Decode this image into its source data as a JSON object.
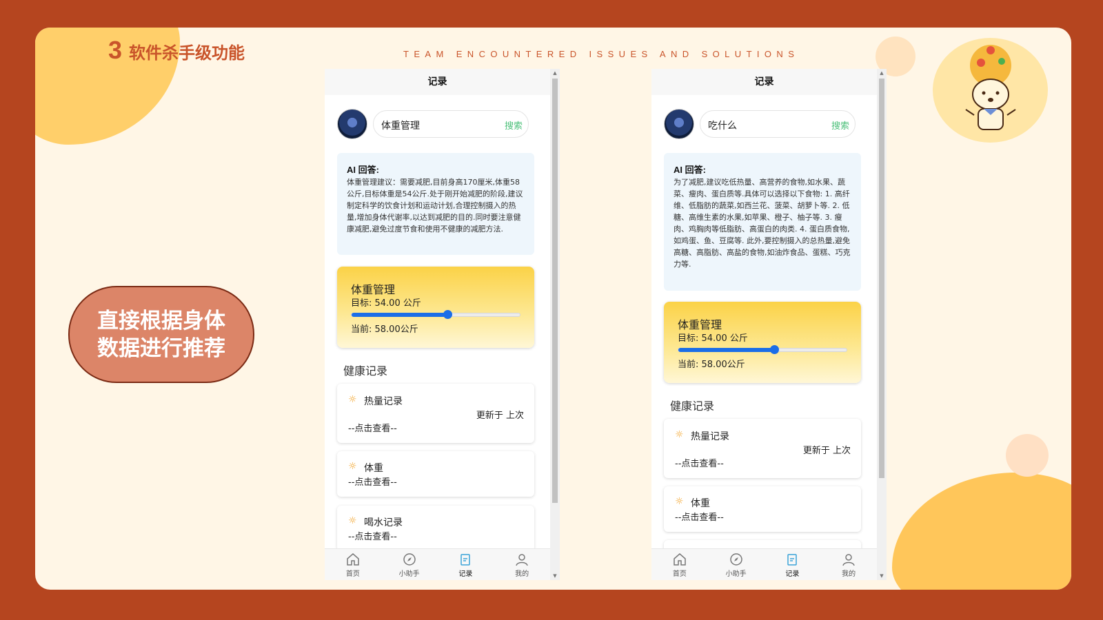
{
  "slide": {
    "number": "3",
    "title": "软件杀手级功能",
    "subtitle": "TEAM ENCOUNTERED ISSUES AND SOLUTIONS",
    "callout": "直接根据身体\n数据进行推荐"
  },
  "phones": [
    {
      "navbar_title": "记录",
      "search_query": "体重管理",
      "search_button": "搜索",
      "ai_label": "AI 回答:",
      "ai_answer": "体重管理建议：需要减肥,目前身高170厘米,体重58公斤,目标体重是54公斤.处于刚开始减肥的阶段,建议制定科学的饮食计划和运动计划,合理控制摄入的热量,增加身体代谢率,以达到减肥的目的.同时要注意健康减肥,避免过度节食和使用不健康的减肥方法.",
      "weight": {
        "title": "体重管理",
        "target": "目标: 54.00 公斤",
        "current": "当前: 58.00公斤",
        "slider_fraction": 0.57
      },
      "health_title": "健康记录",
      "records": [
        {
          "title": "热量记录",
          "tap": "--点击查看--",
          "updated": "更新于 上次"
        },
        {
          "title": "体重",
          "tap": "--点击查看--"
        },
        {
          "title": "喝水记录",
          "tap": "--点击查看--"
        }
      ],
      "tabs": [
        "首页",
        "小助手",
        "记录",
        "我的"
      ]
    },
    {
      "navbar_title": "记录",
      "search_query": "吃什么",
      "search_button": "搜索",
      "ai_label": "AI 回答:",
      "ai_answer": "为了减肥,建议吃低热量、高营养的食物,如水果、蔬菜、瘦肉、蛋白质等.具体可以选择以下食物: 1. 高纤维、低脂肪的蔬菜,如西兰花、菠菜、胡萝卜等. 2. 低糖、高维生素的水果,如苹果、橙子、柚子等. 3. 瘦肉、鸡胸肉等低脂肪、高蛋白的肉类. 4. 蛋白质食物,如鸡蛋、鱼、豆腐等. 此外,要控制摄入的总热量,避免高糖、高脂肪、高盐的食物,如油炸食品、蛋糕、巧克力等.",
      "weight": {
        "title": "体重管理",
        "target": "目标: 54.00 公斤",
        "current": "当前: 58.00公斤",
        "slider_fraction": 0.57
      },
      "health_title": "健康记录",
      "records": [
        {
          "title": "热量记录",
          "tap": "--点击查看--",
          "updated": "更新于 上次"
        },
        {
          "title": "体重",
          "tap": "--点击查看--"
        }
      ],
      "tabs": [
        "首页",
        "小助手",
        "记录",
        "我的"
      ]
    }
  ],
  "colors": {
    "accent": "#c9542a",
    "search_button": "#4cc07a",
    "slider": "#1b6ee8",
    "active_tab_icon": "#3aa3d8"
  },
  "icons": [
    "home-icon",
    "compass-icon",
    "record-icon",
    "user-icon",
    "sun-icon"
  ]
}
